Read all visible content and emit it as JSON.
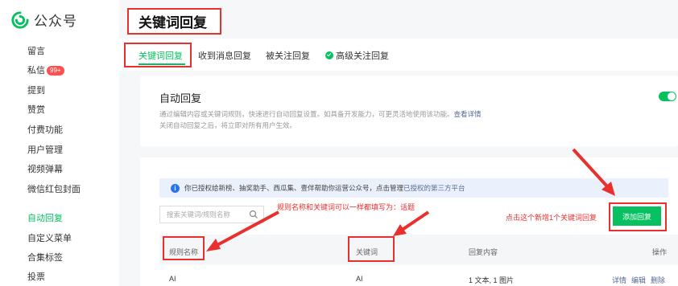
{
  "brand": {
    "name": "公众号"
  },
  "sidebar": {
    "items": [
      {
        "label": "留言"
      },
      {
        "label": "私信",
        "badge": "99+"
      },
      {
        "label": "提到"
      },
      {
        "label": "赞赏"
      },
      {
        "label": "付费功能"
      },
      {
        "label": "用户管理"
      },
      {
        "label": "视频弹幕"
      },
      {
        "label": "微信红包封面"
      },
      {
        "label": "自动回复",
        "active": true
      },
      {
        "label": "自定义菜单"
      },
      {
        "label": "合集标签"
      },
      {
        "label": "投票"
      }
    ]
  },
  "page": {
    "title": "关键词回复"
  },
  "tabs": [
    {
      "label": "关键词回复",
      "active": true
    },
    {
      "label": "收到消息回复"
    },
    {
      "label": "被关注回复"
    },
    {
      "label": "高级关注回复"
    }
  ],
  "auto_reply": {
    "title": "自动回复",
    "desc_line1": "通过编辑内容或关键词规则，快速进行自动回复设置。如具备开发能力，可更灵活地使用该功能。",
    "desc_link": "查看详情",
    "desc_line2": "关闭自动回复之后，将立即对所有用户生效。",
    "enabled": true
  },
  "notice": {
    "text": "你已授权给新榜、抽奖助手、西瓜集、壹伴帮助你运营公众号，点击管理",
    "link": "已授权的第三方平台"
  },
  "search": {
    "placeholder": "搜索关键词/规则名称"
  },
  "annotations": {
    "rule_note": "规则名称和关键词可以一样都填写为：话题",
    "add_note": "点击这个新增1个关键词回复"
  },
  "add_button": {
    "label": "添加回复"
  },
  "table": {
    "headers": {
      "rule_name": "规则名称",
      "keyword": "关键词",
      "reply_content": "回复内容",
      "actions": "操作"
    },
    "rows": [
      {
        "rule_name": "AI",
        "keyword": "AI",
        "reply_content": "1 文本, 1 图片",
        "actions": [
          "详情",
          "编辑",
          "删除"
        ]
      }
    ]
  },
  "colors": {
    "accent": "#07c160",
    "annotation": "#e8302e",
    "link": "#576b95"
  }
}
